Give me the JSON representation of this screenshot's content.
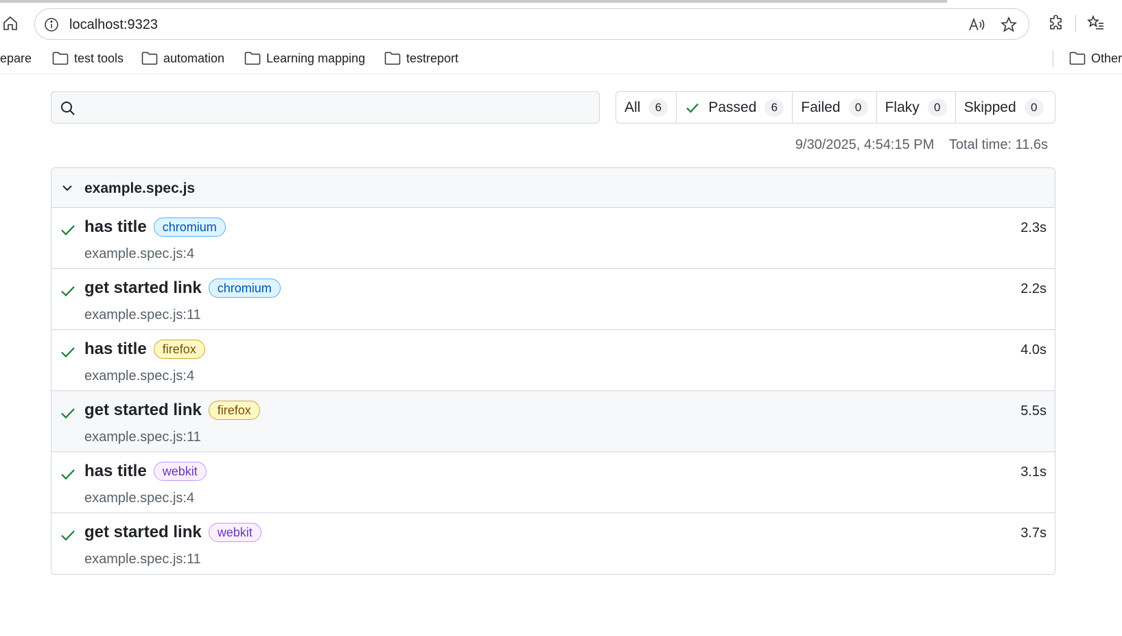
{
  "browser": {
    "url": "localhost:9323",
    "bookmarks": [
      {
        "label": "epare",
        "folder": false
      },
      {
        "label": "test tools",
        "folder": true
      },
      {
        "label": "automation",
        "folder": true
      },
      {
        "label": "Learning mapping",
        "folder": true
      },
      {
        "label": "testreport",
        "folder": true
      },
      {
        "label": "Other",
        "folder": true
      }
    ]
  },
  "report": {
    "search": {
      "value": "",
      "placeholder": ""
    },
    "filters": [
      {
        "label": "All",
        "count": "6"
      },
      {
        "label": "Passed",
        "count": "6",
        "icon": "check-icon"
      },
      {
        "label": "Failed",
        "count": "0"
      },
      {
        "label": "Flaky",
        "count": "0"
      },
      {
        "label": "Skipped",
        "count": "0"
      }
    ],
    "timestamp": "9/30/2025, 4:54:15 PM",
    "total_time": "Total time: 11.6s",
    "file": {
      "name": "example.spec.js",
      "tests": [
        {
          "title": "has title",
          "project": "chromium",
          "location": "example.spec.js:4",
          "duration": "2.3s",
          "status": "passed"
        },
        {
          "title": "get started link",
          "project": "chromium",
          "location": "example.spec.js:11",
          "duration": "2.2s",
          "status": "passed"
        },
        {
          "title": "has title",
          "project": "firefox",
          "location": "example.spec.js:4",
          "duration": "4.0s",
          "status": "passed"
        },
        {
          "title": "get started link",
          "project": "firefox",
          "location": "example.spec.js:11",
          "duration": "5.5s",
          "status": "passed"
        },
        {
          "title": "has title",
          "project": "webkit",
          "location": "example.spec.js:4",
          "duration": "3.1s",
          "status": "passed"
        },
        {
          "title": "get started link",
          "project": "webkit",
          "location": "example.spec.js:11",
          "duration": "3.7s",
          "status": "passed"
        }
      ]
    }
  },
  "colors": {
    "pass_green": "#1a7f37",
    "chromium_tag": "#0550ae",
    "firefox_tag": "#7d4e00",
    "webkit_tag": "#6639ba"
  }
}
